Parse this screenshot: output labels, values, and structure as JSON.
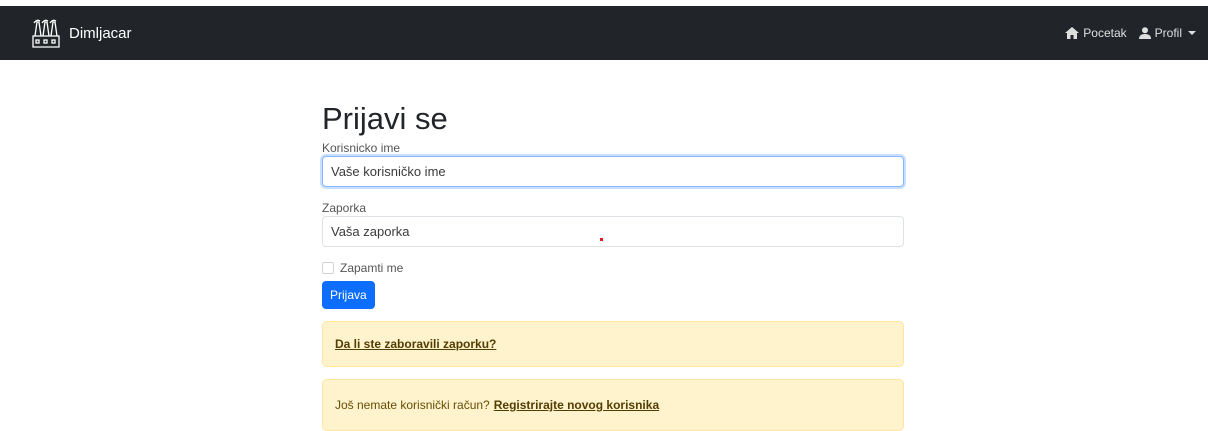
{
  "navbar": {
    "brand": "Dimljacar",
    "links": [
      {
        "label": "Pocetak",
        "icon": "home-icon"
      },
      {
        "label": "Profil",
        "icon": "user-icon"
      }
    ]
  },
  "login": {
    "title": "Prijavi se",
    "username_label": "Korisnicko ime",
    "username_placeholder": "Vaše korisničko ime",
    "password_label": "Zaporka",
    "password_placeholder": "Vaša zaporka",
    "remember_label": "Zapamti me",
    "submit_label": "Prijava"
  },
  "alerts": {
    "forgot_link": "Da li ste zaboravili zaporku?",
    "no_account_text": "Još nemate korisnički račun?",
    "register_link": "Registrirajte novog korisnika"
  },
  "colors": {
    "navbar_bg": "#212529",
    "primary": "#0d6efd",
    "alert_bg": "#fff3cd",
    "alert_link": "#523e02"
  }
}
